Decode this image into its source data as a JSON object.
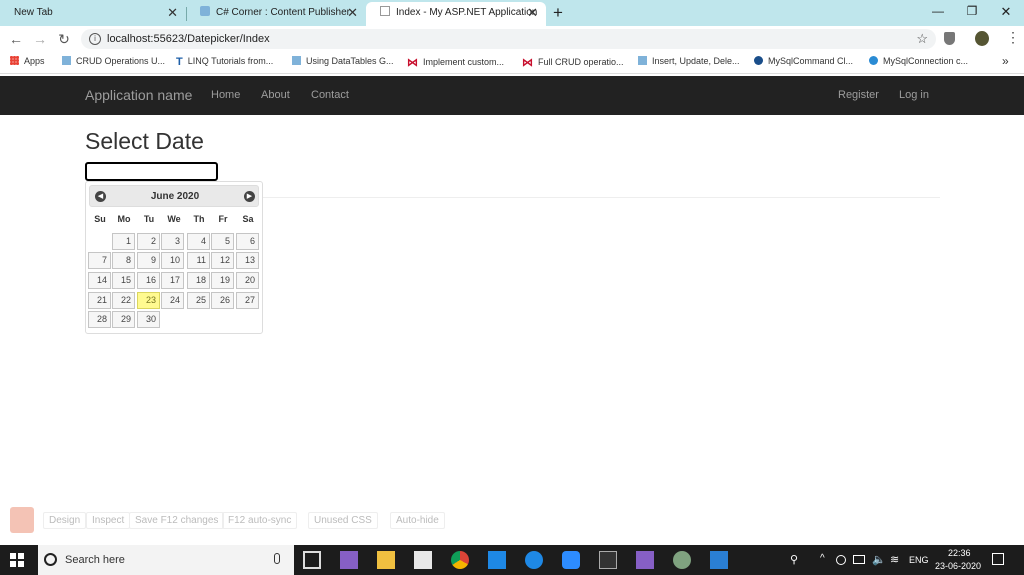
{
  "browser": {
    "tabs": [
      {
        "title": "New Tab"
      },
      {
        "title": "C# Corner : Content Publisher"
      },
      {
        "title": "Index - My ASP.NET Application"
      }
    ],
    "url": "localhost:55623/Datepicker/Index",
    "bookmarks": [
      {
        "label": "Apps",
        "icon": "apps-grid-icon",
        "color": "#e94235"
      },
      {
        "label": "CRUD Operations U...",
        "icon": "page-icon",
        "color": "#7fb2d9"
      },
      {
        "label": "LINQ Tutorials from...",
        "icon": "t-logo-icon",
        "color": "#1e5fa8"
      },
      {
        "label": "Using DataTables G...",
        "icon": "page-icon",
        "color": "#7fb2d9"
      },
      {
        "label": "Implement custom...",
        "icon": "visual-studio-icon",
        "color": "#c8102e"
      },
      {
        "label": "Full CRUD operatio...",
        "icon": "visual-studio-icon",
        "color": "#c8102e"
      },
      {
        "label": "Insert, Update, Dele...",
        "icon": "page-icon",
        "color": "#7fb2d9"
      },
      {
        "label": "MySqlCommand Cl...",
        "icon": "mysql-icon",
        "color": "#1a4e8a"
      },
      {
        "label": "MySqlConnection c...",
        "icon": "azure-icon",
        "color": "#2a8bd4"
      }
    ]
  },
  "navbar": {
    "brand": "Application name",
    "links": [
      "Home",
      "About",
      "Contact"
    ],
    "right_links": [
      "Register",
      "Log in"
    ]
  },
  "page": {
    "title": "Select Date",
    "date_value": ""
  },
  "datepicker": {
    "month_title": "June 2020",
    "prev_label": "Prev",
    "next_label": "Next",
    "weekdays": [
      "Su",
      "Mo",
      "Tu",
      "We",
      "Th",
      "Fr",
      "Sa"
    ],
    "first_weekday_index": 1,
    "days_in_month": 30,
    "highlight_day": 23,
    "highlight_color": "#fffa90"
  },
  "devtools_bar": {
    "items": [
      "Design",
      "Inspect",
      "Save F12 changes",
      "F12 auto-sync",
      "Unused CSS",
      "Auto-hide"
    ]
  },
  "taskbar": {
    "search_placeholder": "Search here",
    "language": "ENG",
    "time": "22:36",
    "date": "23-06-2020"
  }
}
